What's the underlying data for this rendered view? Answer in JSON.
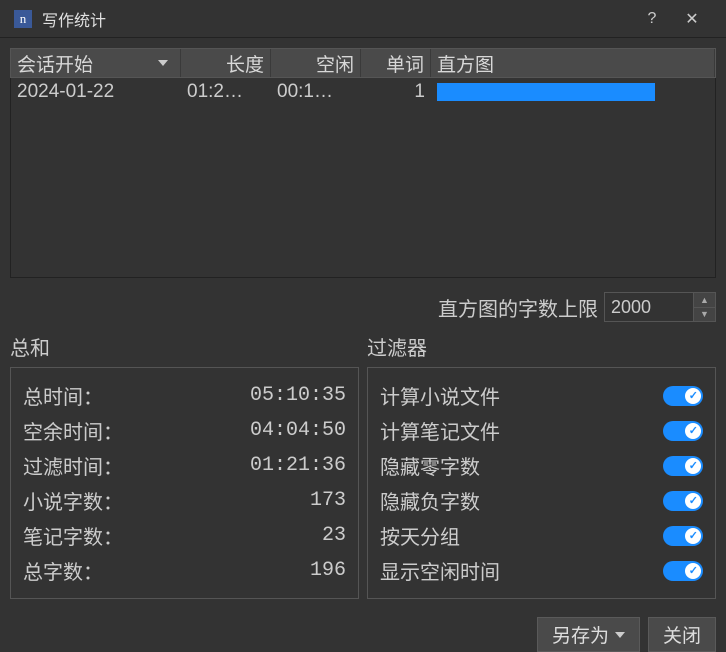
{
  "window": {
    "title": "写作统计",
    "help": "?",
    "close": "✕"
  },
  "table": {
    "headers": {
      "session": "会话开始",
      "length": "长度",
      "idle": "空闲",
      "words": "单词",
      "histogram": "直方图"
    },
    "rows": [
      {
        "session": "2024-01-22",
        "length": "01:2…",
        "idle": "00:1…",
        "words": "1"
      }
    ]
  },
  "limit": {
    "label": "直方图的字数上限",
    "value": "2000"
  },
  "totals": {
    "title": "总和",
    "items": [
      {
        "label": "总时间：",
        "value": "05:10:35"
      },
      {
        "label": "空余时间：",
        "value": "04:04:50"
      },
      {
        "label": "过滤时间：",
        "value": "01:21:36"
      },
      {
        "label": "小说字数：",
        "value": "173"
      },
      {
        "label": "笔记字数：",
        "value": "23"
      },
      {
        "label": "总字数：",
        "value": "196"
      }
    ]
  },
  "filters": {
    "title": "过滤器",
    "items": [
      {
        "label": "计算小说文件"
      },
      {
        "label": "计算笔记文件"
      },
      {
        "label": "隐藏零字数"
      },
      {
        "label": "隐藏负字数"
      },
      {
        "label": "按天分组"
      },
      {
        "label": "显示空闲时间"
      }
    ]
  },
  "buttons": {
    "saveAs": "另存为",
    "close": "关闭"
  }
}
